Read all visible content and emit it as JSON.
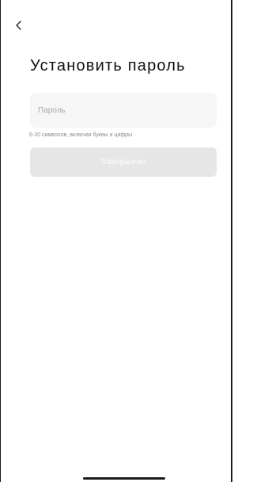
{
  "header": {
    "back_icon": "chevron-left-icon"
  },
  "main": {
    "title": "Установить пароль",
    "password_field": {
      "placeholder": "Пароль",
      "value": ""
    },
    "hint": "6-20 символов, включая буквы и цифры",
    "submit_label": "Завершено",
    "submit_enabled": false
  },
  "colors": {
    "field_background": "#f6f6f6",
    "button_disabled_background": "#e6e6e6",
    "button_text": "#ffffff",
    "title_text": "#111111",
    "hint_text": "#8a8a8a"
  }
}
